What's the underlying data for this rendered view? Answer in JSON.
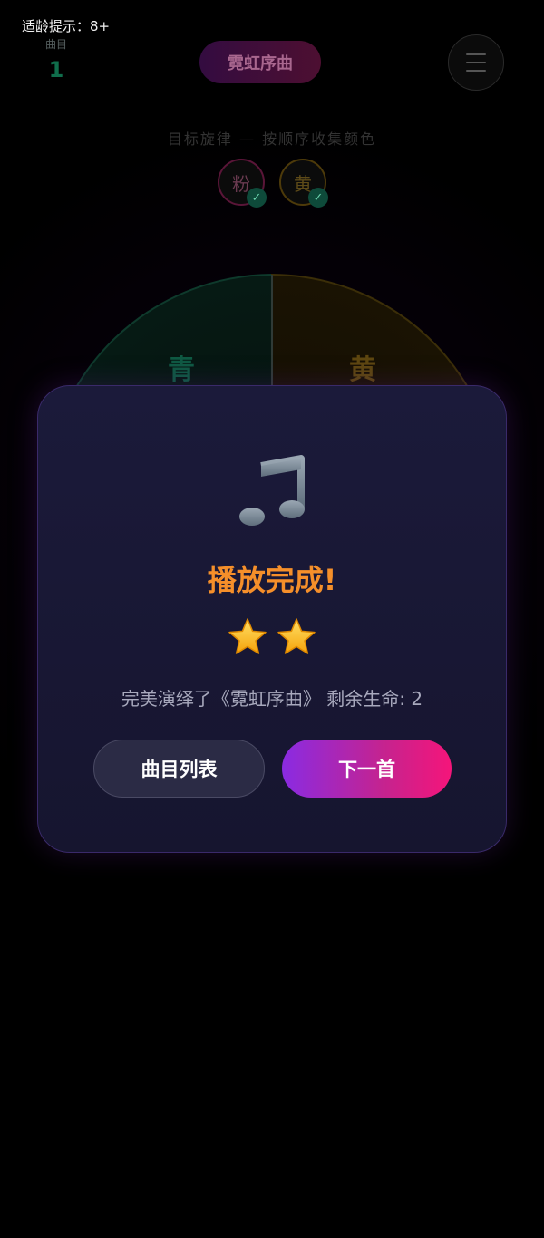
{
  "status": {
    "age_hint": "适龄提示：8+"
  },
  "header": {
    "song_label": "曲目",
    "song_number": "1",
    "title": "霓虹序曲",
    "menu_icon": "hamburger-menu-icon"
  },
  "target": {
    "instruction": "目标旋律 — 按顺序收集颜色",
    "colors": [
      {
        "label": "粉",
        "color": "#e6157a",
        "done": true
      },
      {
        "label": "黄",
        "color": "#f5a623",
        "done": true
      }
    ]
  },
  "wheel": {
    "segments": [
      {
        "label": "青",
        "color": "#1ec98a"
      },
      {
        "label": "黄",
        "color": "#f5a623"
      }
    ]
  },
  "dialog": {
    "icon": "music-note-icon",
    "title": "播放完成!",
    "stars_earned": 2,
    "summary": "完美演绎了《霓虹序曲》 剩余生命: 2",
    "song_list_button": "曲目列表",
    "next_button": "下一首"
  },
  "colors": {
    "accent_orange": "#f58f2a",
    "gradient_start": "#8a2be2",
    "gradient_end": "#f5157a",
    "modal_bg": "#1b1a3a"
  }
}
